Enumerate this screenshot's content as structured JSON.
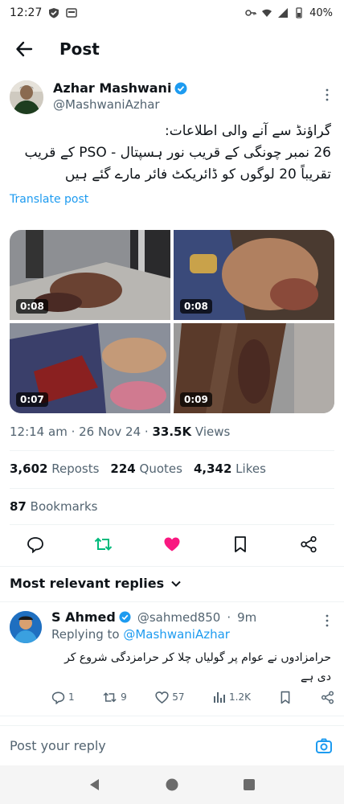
{
  "status_bar": {
    "time": "12:27",
    "battery": "40%"
  },
  "header": {
    "title": "Post"
  },
  "author": {
    "name": "Azhar Mashwani",
    "handle": "@MashwaniAzhar"
  },
  "post": {
    "lines": [
      "گراؤنڈ سے آنے والی اطلاعات:",
      "26 نمبر چونگی کے قریب نور ہسپتال - PSO کے قریب",
      "تقریباً 20 لوگوں کو ڈائریکٹ فائر مارے گئے ہیں"
    ],
    "translate_label": "Translate post"
  },
  "media": [
    {
      "duration": "0:08"
    },
    {
      "duration": "0:08"
    },
    {
      "duration": "0:07"
    },
    {
      "duration": "0:09"
    }
  ],
  "meta": {
    "time": "12:14 am",
    "date": "26 Nov 24",
    "views_count": "33.5K",
    "views_label": "Views"
  },
  "stats": {
    "reposts_count": "3,602",
    "reposts_label": "Reposts",
    "quotes_count": "224",
    "quotes_label": "Quotes",
    "likes_count": "4,342",
    "likes_label": "Likes",
    "bookmarks_count": "87",
    "bookmarks_label": "Bookmarks"
  },
  "colors": {
    "accent": "#1d9bf0",
    "repost": "#00ba7c",
    "like": "#f91880",
    "text": "#0f1419",
    "muted": "#536471"
  },
  "replies": {
    "heading": "Most relevant replies",
    "items": [
      {
        "name": "S Ahmed",
        "handle": "@sahmed850",
        "time": "9m",
        "replying_prefix": "Replying to",
        "replying_to": "@MashwaniAzhar",
        "text": "حرامزادوں نے عوام پر گولیاں چلا کر حرامزدگی شروع کر دی ہے",
        "reply_count": "1",
        "repost_count": "9",
        "like_count": "57",
        "views": "1.2K"
      }
    ]
  },
  "compose": {
    "placeholder": "Post your reply"
  }
}
